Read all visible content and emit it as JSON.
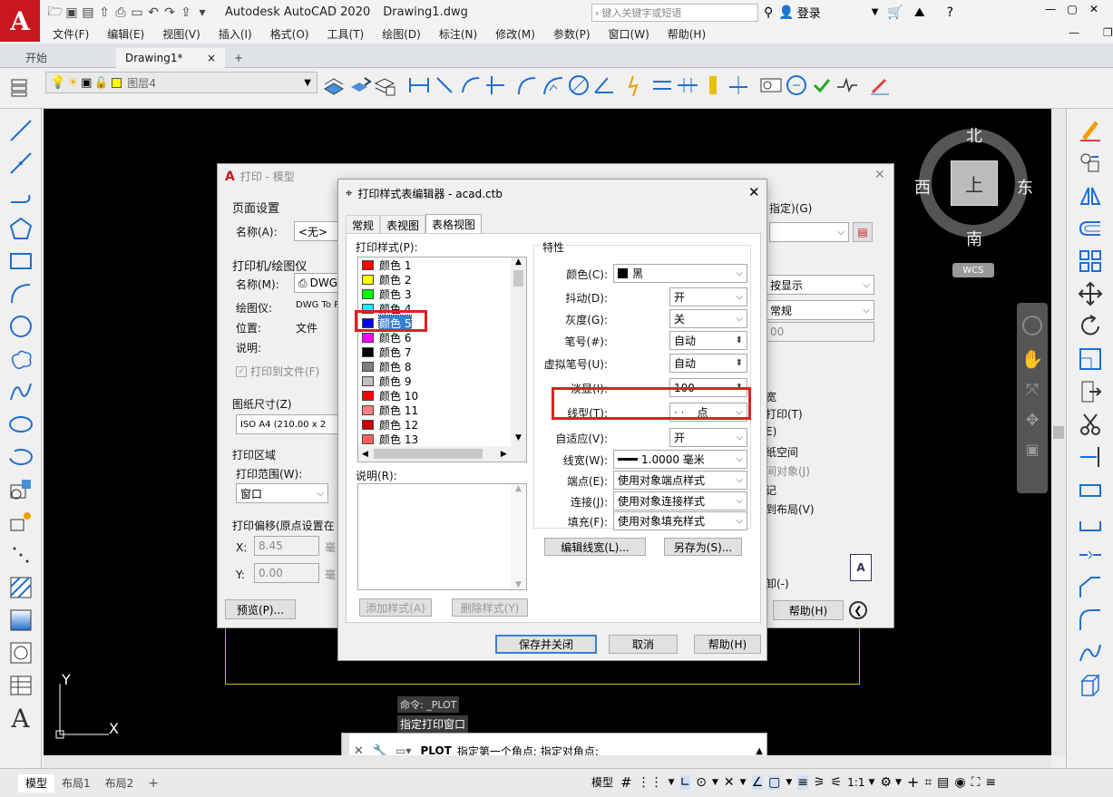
{
  "app": {
    "title": "Autodesk AutoCAD 2020",
    "document": "Drawing1.dwg",
    "search_placeholder": "键入关键字或短语",
    "login": "登录"
  },
  "menu": [
    "文件(F)",
    "编辑(E)",
    "视图(V)",
    "插入(I)",
    "格式(O)",
    "工具(T)",
    "绘图(D)",
    "标注(N)",
    "修改(M)",
    "参数(P)",
    "窗口(W)",
    "帮助(H)"
  ],
  "file_tabs": [
    {
      "label": "开始"
    },
    {
      "label": "Drawing1*",
      "close": "×"
    }
  ],
  "add_tab": "+",
  "ribbon": {
    "layer_name": "图层4"
  },
  "viewcube": {
    "north": "北",
    "south": "南",
    "east": "东",
    "west": "西",
    "top": "上",
    "wcs": "WCS"
  },
  "axes": {
    "y": "Y",
    "x": "X"
  },
  "command": {
    "history": [
      "命令: _PLOT",
      "指定打印窗口"
    ],
    "prompt_cmd": "PLOT",
    "prompt_text": "指定第一个角点: 指定对角点:"
  },
  "layout_tabs": [
    "模型",
    "布局1",
    "布局2"
  ],
  "status": {
    "model": "模型",
    "scale": "1:1"
  },
  "plot_dialog": {
    "title": "打印 - 模型",
    "page_setup": "页面设置",
    "name_label": "名称(A):",
    "name_value": "<无>",
    "printer": "打印机/绘图仪",
    "printer_name_label": "名称(M):",
    "printer_name": "DWG",
    "plotter_label": "绘图仪:",
    "plotter_value": "DWG To P",
    "location_label": "位置:",
    "location_value": "文件",
    "desc_label": "说明:",
    "plot_to_file": "打印到文件(F)",
    "paper_size": "图纸尺寸(Z)",
    "paper_value": "ISO A4 (210.00 x 2",
    "plot_area": "打印区域",
    "plot_range": "打印范围(W):",
    "plot_range_value": "窗口",
    "plot_offset": "打印偏移(原点设置在",
    "x_label": "X:",
    "x_value": "8.45",
    "y_label": "Y:",
    "y_value": "0.00",
    "unit": "毫",
    "preview": "预览(P)...",
    "help": "帮助(H)",
    "right_spec": "指定)(G)",
    "right_display": "按显示",
    "right_normal": "常规",
    "right_00": "00",
    "opt1": "宽",
    "opt2": "打印(T)",
    "opt3": "E)",
    "opt4": "纸空间",
    "opt5": "间对象(J)",
    "opt6": "记",
    "opt7": "到布局(V)",
    "opt8": "卸(-)"
  },
  "style_editor": {
    "title": "打印样式表编辑器 - acad.ctb",
    "tabs": [
      "常规",
      "表视图",
      "表格视图"
    ],
    "styles_label": "打印样式(P):",
    "styles": [
      {
        "name": "颜色 1",
        "color": "#ff0000"
      },
      {
        "name": "颜色 2",
        "color": "#ffff00"
      },
      {
        "name": "颜色 3",
        "color": "#00ff00"
      },
      {
        "name": "颜色 4",
        "color": "#00ffff"
      },
      {
        "name": "颜色 5",
        "color": "#0000ff"
      },
      {
        "name": "颜色 6",
        "color": "#ff00ff"
      },
      {
        "name": "颜色 7",
        "color": "#000000"
      },
      {
        "name": "颜色 8",
        "color": "#808080"
      },
      {
        "name": "颜色 9",
        "color": "#c0c0c0"
      },
      {
        "name": "颜色 10",
        "color": "#ff0000"
      },
      {
        "name": "颜色 11",
        "color": "#ff8080"
      },
      {
        "name": "颜色 12",
        "color": "#cc0000"
      },
      {
        "name": "颜色 13",
        "color": "#ff6060"
      }
    ],
    "selected_index": 4,
    "desc_label": "说明(R):",
    "add_style": "添加样式(A)",
    "delete_style": "删除样式(Y)",
    "props_label": "特性",
    "props": [
      {
        "label": "颜色(C):",
        "value": "黑",
        "kind": "combo"
      },
      {
        "label": "抖动(D):",
        "value": "开",
        "kind": "combo"
      },
      {
        "label": "灰度(G):",
        "value": "关",
        "kind": "combo"
      },
      {
        "label": "笔号(#):",
        "value": "自动",
        "kind": "spin"
      },
      {
        "label": "虚拟笔号(U):",
        "value": "自动",
        "kind": "spin"
      },
      {
        "label": "淡显(I):",
        "value": "100",
        "kind": "spin"
      },
      {
        "label": "线型(T):",
        "value": "点",
        "kind": "combo"
      },
      {
        "label": "自适应(V):",
        "value": "开",
        "kind": "combo"
      },
      {
        "label": "线宽(W):",
        "value": "1.0000 毫米",
        "kind": "combo"
      },
      {
        "label": "端点(E):",
        "value": "使用对象端点样式",
        "kind": "combo"
      },
      {
        "label": "连接(J):",
        "value": "使用对象连接样式",
        "kind": "combo"
      },
      {
        "label": "填充(F):",
        "value": "使用对象填充样式",
        "kind": "combo"
      }
    ],
    "edit_lineweight": "编辑线宽(L)...",
    "save_as": "另存为(S)...",
    "save_close": "保存并关闭",
    "cancel": "取消",
    "help": "帮助(H)"
  }
}
